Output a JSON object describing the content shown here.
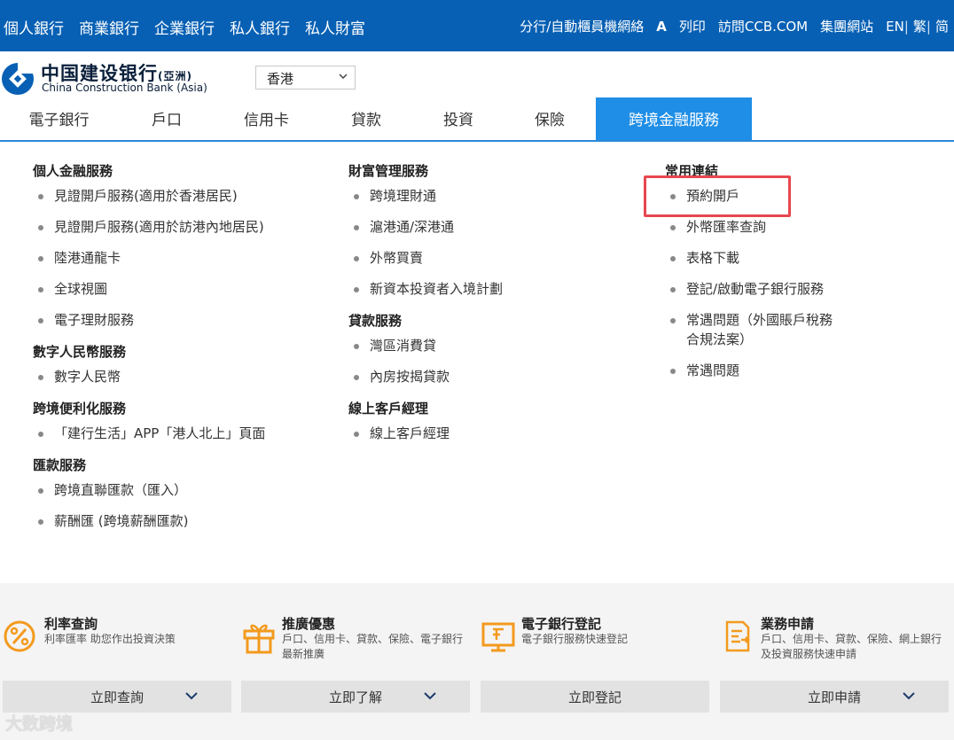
{
  "topbar": {
    "left": [
      "個人銀行",
      "商業銀行",
      "企業銀行",
      "私人銀行",
      "私人財富"
    ],
    "branch": "分行/自動櫃員機網絡",
    "text_size": "A",
    "print": "列印",
    "visit": "訪問CCB.COM",
    "group": "集團網站",
    "lang_en": "EN",
    "lang_tc": "繁",
    "lang_sc": "简"
  },
  "header": {
    "logo_cn": "中国建设银行",
    "logo_cn_suffix": "(亞洲)",
    "logo_en": "China Construction Bank (Asia)",
    "region": "香港"
  },
  "nav": [
    "電子銀行",
    "戶口",
    "信用卡",
    "貸款",
    "投資",
    "保險",
    "跨境金融服務"
  ],
  "menu": {
    "col1": [
      {
        "title": "個人金融服務",
        "links": [
          "見證開戶服務(適用於香港居民)",
          "見證開戶服務(適用於訪港內地居民)",
          "陸港通龍卡",
          "全球視圖",
          "電子理財服務"
        ]
      },
      {
        "title": "數字人民幣服務",
        "links": [
          "數字人民幣"
        ]
      },
      {
        "title": "跨境便利化服務",
        "links": [
          "「建行生活」APP「港人北上」頁面"
        ]
      },
      {
        "title": "匯款服務",
        "links": [
          "跨境直聯匯款（匯入）",
          "薪酬匯 (跨境薪酬匯款)"
        ]
      }
    ],
    "col2": [
      {
        "title": "財富管理服務",
        "links": [
          "跨境理財通",
          "滬港通/深港通",
          "外幣買賣",
          "新資本投資者入境計劃"
        ]
      },
      {
        "title": "貸款服務",
        "links": [
          "灣區消費貸",
          "內房按揭貸款"
        ]
      },
      {
        "title": "線上客戶經理",
        "links": [
          "線上客戶經理"
        ]
      }
    ],
    "col3": [
      {
        "title": "常用連結",
        "links": [
          "預約開戶",
          "外幣匯率查詢",
          "表格下載",
          "登記/啟動電子銀行服務",
          "常遇問題（外國賬戶稅務\n合規法案）",
          "常遇問題"
        ]
      }
    ]
  },
  "cards": [
    {
      "title": "利率查詢",
      "desc": "利率匯率 助您作出投資決策",
      "button": "立即查詢"
    },
    {
      "title": "推廣優惠",
      "desc": "戶口、信用卡、貸款、保險、電子銀行最新推廣",
      "button": "立即了解"
    },
    {
      "title": "電子銀行登記",
      "desc": "電子銀行服務快速登記",
      "button": "立即登記"
    },
    {
      "title": "業務申請",
      "desc": "戶口、信用卡、貸款、保險、網上銀行及投資服務快速申請",
      "button": "立即申請"
    }
  ],
  "watermark": "大数跨境",
  "colors": {
    "primary": "#0760b4",
    "accent": "#1f8ee6",
    "highlight": "#e8474f",
    "icon": "#f39a1e"
  }
}
